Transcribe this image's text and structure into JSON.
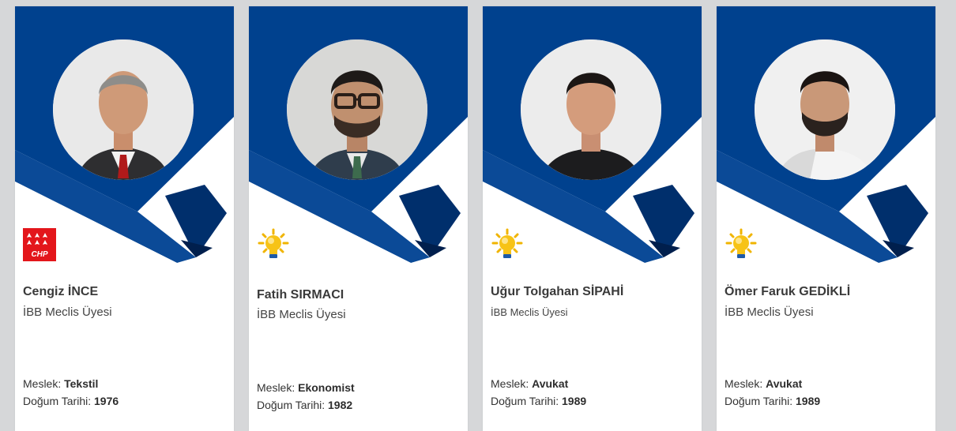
{
  "colors": {
    "banner_blue": "#00418e",
    "banner_dark": "#002f6c",
    "page_bg": "#d6d7d9",
    "card_bg": "#ffffff"
  },
  "labels": {
    "meslek_prefix": "Meslek: ",
    "dogum_prefix": "Doğum Tarihi: "
  },
  "members": [
    {
      "name": "Cengiz İNCE",
      "role": "İBB Meclis Üyesi",
      "party_icon": "chp-logo-icon",
      "party_text": "CHP",
      "meslek": "Tekstil",
      "dogum_tarihi": "1976"
    },
    {
      "name": "Fatih SIRMACI",
      "role": "İBB Meclis Üyesi",
      "party_icon": "ak-parti-bulb-icon",
      "meslek": "Ekonomist",
      "dogum_tarihi": "1982"
    },
    {
      "name": "Uğur Tolgahan SİPAHİ",
      "role": "İBB Meclis Üyesi",
      "party_icon": "ak-parti-bulb-icon",
      "meslek": "Avukat",
      "dogum_tarihi": "1989"
    },
    {
      "name": "Ömer Faruk GEDİKLİ",
      "role": "İBB Meclis Üyesi",
      "party_icon": "ak-parti-bulb-icon",
      "meslek": "Avukat",
      "dogum_tarihi": "1989"
    }
  ]
}
